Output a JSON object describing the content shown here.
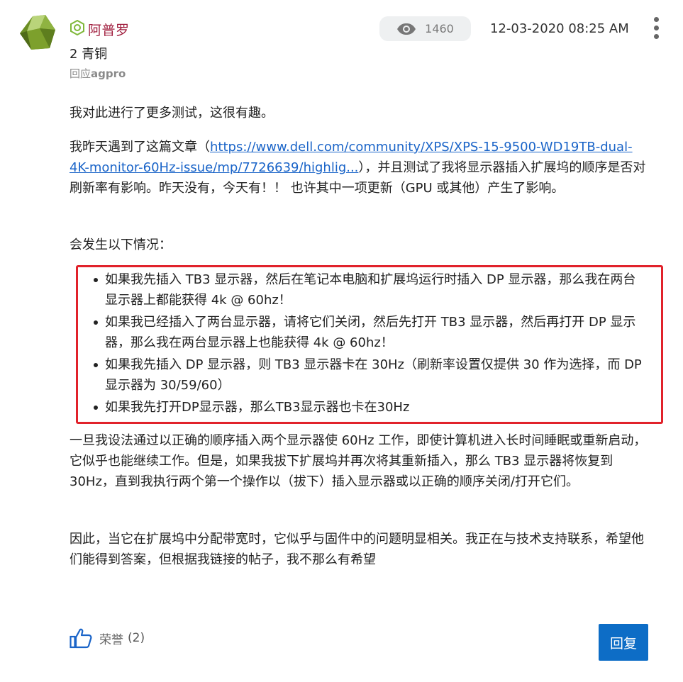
{
  "author": {
    "name": "阿普罗",
    "rank": "2 青铜",
    "reply_prefix": "回应",
    "reply_to": "agpro"
  },
  "meta": {
    "views": "1460",
    "timestamp": "12-03-2020 08:25 AM"
  },
  "post": {
    "p1": "我对此进行了更多测试，这很有趣。",
    "p2_before": "我昨天遇到了这篇文章（",
    "p2_link": "https://www.dell.com/community/XPS/XPS-15-9500-WD19TB-dual-4K-monitor-60Hz-issue/mp/7726639/highlig...",
    "p2_after": "），并且测试了我将显示器插入扩展坞的顺序是否对刷新率有影响。昨天没有，今天有！！ 也许其中一项更新（GPU 或其他）产生了影响。",
    "p3": "会发生以下情况：",
    "bullets": [
      "如果我先插入 TB3 显示器，然后在笔记本电脑和扩展坞运行时插入 DP 显示器，那么我在两台显示器上都能获得 4k @ 60hz！",
      "如果我已经插入了两台显示器，请将它们关闭，然后先打开 TB3 显示器，然后再打开 DP 显示器，那么我在两台显示器上也能获得 4k @ 60hz！",
      "如果我先插入 DP 显示器，则 TB3 显示器卡在 30Hz（刷新率设置仅提供 30 作为选择，而 DP 显示器为 30/59/60）",
      "如果我先打开DP显示器，那么TB3显示器也卡在30Hz"
    ],
    "p4": "一旦我设法通过以正确的顺序插入两个显示器使 60Hz 工作，即使计算机进入长时间睡眠或重新启动，它似乎也能继续工作。但是，如果我拔下扩展坞并再次将其重新插入，那么 TB3 显示器将恢复到 30Hz，直到我执行两个第一个操作以（拔下）插入显示器或以正确的顺序关闭/打开它们。",
    "p5": "因此，当它在扩展坞中分配带宽时，它似乎与固件中的问题明显相关。我正在与技术支持联系，希望他们能得到答案，但根据我链接的帖子，我不那么有希望"
  },
  "footer": {
    "kudos_label": "荣誉",
    "kudos_count": "(2)",
    "reply_button": "回复"
  },
  "colors": {
    "author": "#a01e3e",
    "link": "#1a64c8",
    "highlight_border": "#e1222b",
    "reply_button": "#0d6dc6"
  },
  "icons": {
    "rank_badge": "hexagon-badge-icon",
    "views": "eye-icon",
    "menu": "more-vertical-icon",
    "kudos": "thumbs-up-icon"
  }
}
